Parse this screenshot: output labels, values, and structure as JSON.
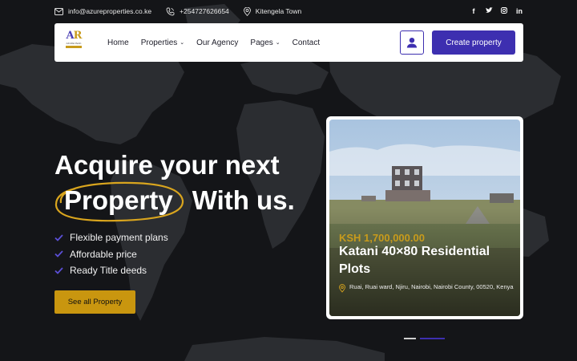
{
  "topbar": {
    "email": "info@azureproperties.co.ke",
    "phone": "+254727626654",
    "location": "Kitengela Town",
    "email_icon": "mail-icon",
    "phone_icon": "phone-icon",
    "location_icon": "map-pin-icon",
    "social": [
      {
        "icon": "facebook-icon",
        "glyph": "f"
      },
      {
        "icon": "twitter-icon",
        "glyph": "🐦"
      },
      {
        "icon": "instagram-icon",
        "glyph": "◎"
      },
      {
        "icon": "linkedin-icon",
        "glyph": "in"
      }
    ]
  },
  "navbar": {
    "logo_mark_a": "A",
    "logo_mark_r": "R",
    "logo_tag": "AZURE PEAK",
    "links": [
      {
        "label": "Home",
        "dropdown": false
      },
      {
        "label": "Properties",
        "dropdown": true
      },
      {
        "label": "Our Agency",
        "dropdown": false
      },
      {
        "label": "Pages",
        "dropdown": true
      },
      {
        "label": "Contact",
        "dropdown": false
      }
    ],
    "create_label": "Create property",
    "accent_color": "#3d2fb0"
  },
  "hero": {
    "title_line1": "Acquire your next",
    "title_highlight": "Property",
    "title_rest": "With us.",
    "features": [
      "Flexible payment plans",
      "Affordable price",
      "Ready Title deeds"
    ],
    "cta_label": "See all Property",
    "cta_color": "#c9960f"
  },
  "property_card": {
    "price": "KSH 1,700,000.00",
    "title": "Katani 40×80 Residential Plots",
    "address": "Ruai, Ruai ward, Njiru, Nairobi, Nairobi County, 00520, Kenya"
  },
  "slider": {
    "slide_count": 2,
    "active_index": 1
  }
}
